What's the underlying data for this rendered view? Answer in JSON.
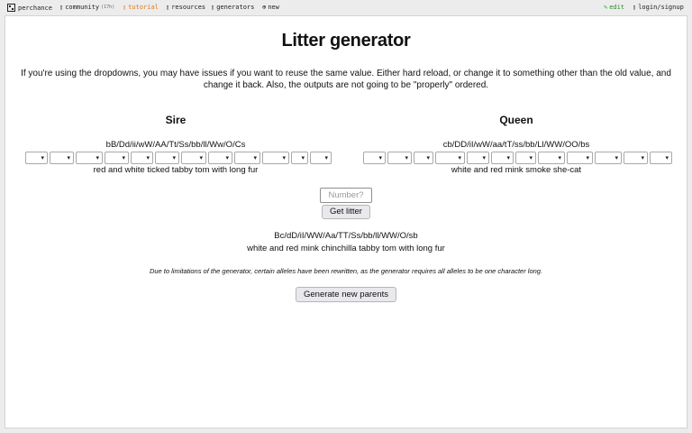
{
  "nav": {
    "brand": "perchance",
    "community": "community",
    "community_count": "(17h)",
    "tutorial": "tutorial",
    "resources": "resources",
    "generators": "generators",
    "new": "new",
    "edit": "edit",
    "login": "login/signup",
    "icons": {
      "brand": "dice-icon",
      "community": "chat-icon",
      "tutorial": "book-icon",
      "resources": "book-icon",
      "generators": "list-icon",
      "new": "plus-circle-icon",
      "edit": "pencil-icon",
      "login": "user-icon"
    }
  },
  "page": {
    "title": "Litter generator",
    "notice": "If you're using the dropdowns, you may have issues if you want to reuse the same value. Either hard reload, or change it to something other than the old value, and change it back. Also, the outputs are not going to be \"properly\" ordered."
  },
  "sire": {
    "heading": "Sire",
    "genotype": "bB/Dd/ii/wW/AA/Tt/Ss/bb/ll/Ww/O/Cs",
    "description": "red and white ticked tabby tom with long fur"
  },
  "queen": {
    "heading": "Queen",
    "genotype": "cb/DD/iI/wW/aa/tT/ss/bb/Ll/WW/OO/bs",
    "description": "white and red mink smoke she-cat"
  },
  "controls": {
    "number_placeholder": "Number?",
    "get_litter": "Get litter",
    "generate_parents": "Generate new parents"
  },
  "result": {
    "genotype": "Bc/dD/iI/WW/Aa/TT/Ss/bb/ll/WW/O/sb",
    "description": "white and red mink chinchilla tabby tom with long fur"
  },
  "note": "Due to limitations of the generator, certain alleles have been rewritten, as the generator requires all alleles to be one character long.",
  "colors": {
    "tutorial": "#e07a1a",
    "edit": "#2e8b2e",
    "background": "#ececec"
  }
}
